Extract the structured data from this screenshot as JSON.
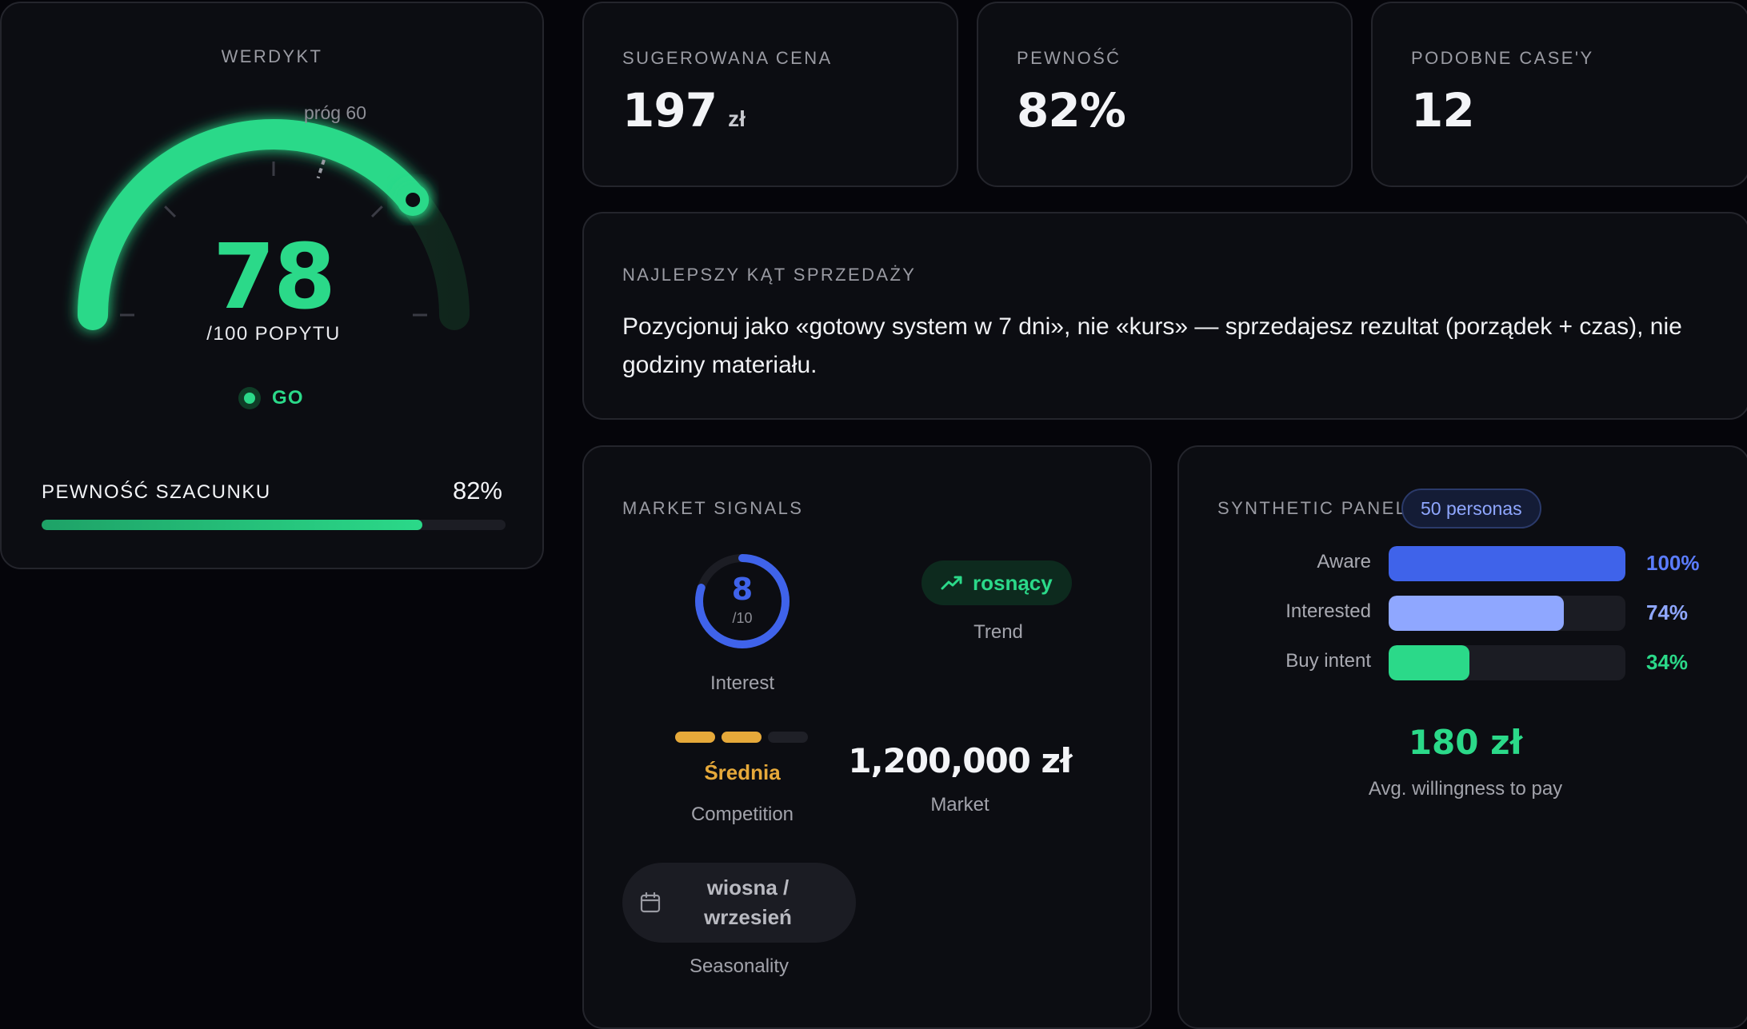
{
  "verdict": {
    "title": "WERDYKT",
    "threshold_label": "próg 60",
    "score": "78",
    "score_value": 78,
    "threshold_value": 60,
    "score_sub": "/100 POPYTU",
    "status": "GO",
    "confidence_label": "PEWNOŚĆ SZACUNKU",
    "confidence_value": "82%",
    "confidence_fraction": 0.82,
    "colors": {
      "accent": "#2bd989"
    }
  },
  "stats": [
    {
      "label": "SUGEROWANA CENA",
      "value": "197",
      "unit": "zł"
    },
    {
      "label": "PEWNOŚĆ",
      "value": "82%",
      "unit": ""
    },
    {
      "label": "PODOBNE CASE'Y",
      "value": "12",
      "unit": ""
    }
  ],
  "angle": {
    "label": "NAJLEPSZY KĄT SPRZEDAŻY",
    "text": "Pozycjonuj jako «gotowy system w 7 dni», nie «kurs» — sprzedajesz rezultat (porządek + czas), nie godziny materiału."
  },
  "market": {
    "title": "MARKET SIGNALS",
    "interest_value": "8",
    "interest_den": "/10",
    "interest_fraction": 0.8,
    "interest_caption": "Interest",
    "trend_icon": "trending-up-icon",
    "trend_value": "rosnący",
    "trend_caption": "Trend",
    "competition_level": "Średnia",
    "competition_filled": 2,
    "competition_total": 3,
    "competition_caption": "Competition",
    "market_value": "1,200,000 zł",
    "market_caption": "Market",
    "seasonality_icon": "calendar-icon",
    "seasonality_value": "wiosna / wrzesień",
    "seasonality_caption": "Seasonality",
    "colors": {
      "interest": "#3f63ea",
      "competition": "#e6a93a",
      "trend": "#2bd989"
    }
  },
  "panel": {
    "title": "SYNTHETIC PANEL",
    "badge": "50 personas",
    "funnel": [
      {
        "name": "Aware",
        "pct": "100%",
        "fraction": 1.0,
        "color": "#3f63ea",
        "text_color": "#5b7cff"
      },
      {
        "name": "Interested",
        "pct": "74%",
        "fraction": 0.74,
        "color": "#8fa7ff",
        "text_color": "#8fa7ff"
      },
      {
        "name": "Buy intent",
        "pct": "34%",
        "fraction": 0.34,
        "color": "#2bd989",
        "text_color": "#2bd989"
      }
    ],
    "wtp_value": "180 zł",
    "wtp_caption": "Avg. willingness to pay"
  }
}
